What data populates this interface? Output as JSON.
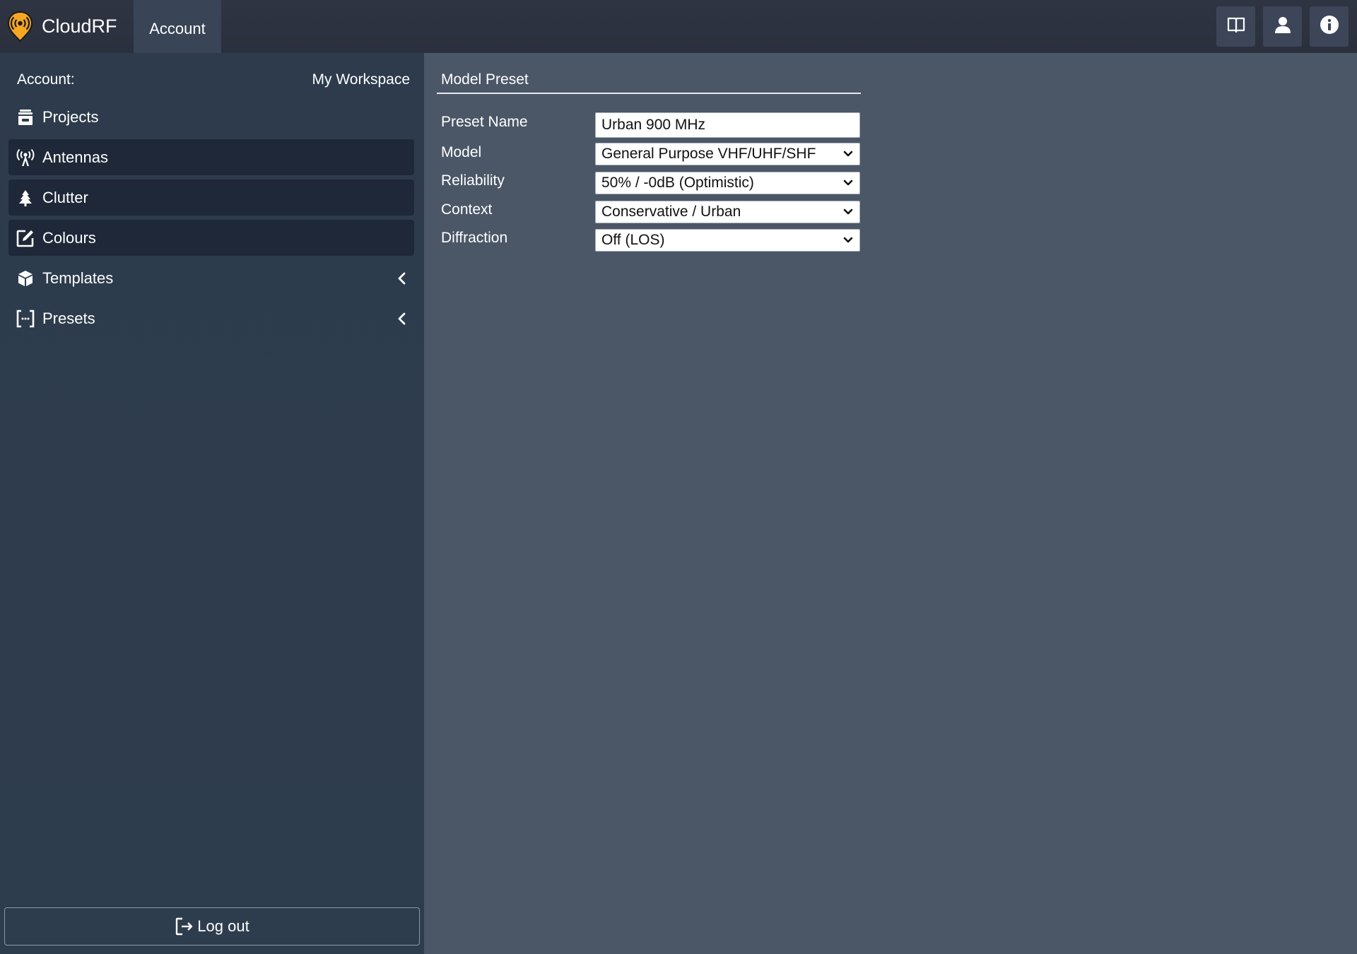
{
  "app": {
    "name": "CloudRF",
    "tab": "Account",
    "brand_color": "#f5a623"
  },
  "top_icons": [
    "book-icon",
    "user-icon",
    "info-icon"
  ],
  "sidebar": {
    "account_label": "Account:",
    "workspace": "My Workspace",
    "items": [
      {
        "label": "Projects",
        "icon": "archive-icon",
        "active": false
      },
      {
        "label": "Antennas",
        "icon": "antenna-icon",
        "active": true
      },
      {
        "label": "Clutter",
        "icon": "tree-icon",
        "active": true
      },
      {
        "label": "Colours",
        "icon": "edit-square-icon",
        "active": true
      },
      {
        "label": "Templates",
        "icon": "cube-icon",
        "active": false,
        "expandable": true
      },
      {
        "label": "Presets",
        "icon": "brackets-icon",
        "active": false,
        "expandable": true
      }
    ],
    "logout_label": "Log out"
  },
  "main": {
    "section_title": "Model Preset",
    "fields": {
      "preset_name": {
        "label": "Preset Name",
        "value": "Urban 900 MHz"
      },
      "model": {
        "label": "Model",
        "value": "General Purpose VHF/UHF/SHF"
      },
      "reliability": {
        "label": "Reliability",
        "value": "50% / -0dB (Optimistic)"
      },
      "context": {
        "label": "Context",
        "value": "Conservative / Urban"
      },
      "diffraction": {
        "label": "Diffraction",
        "value": "Off (LOS)"
      }
    }
  }
}
